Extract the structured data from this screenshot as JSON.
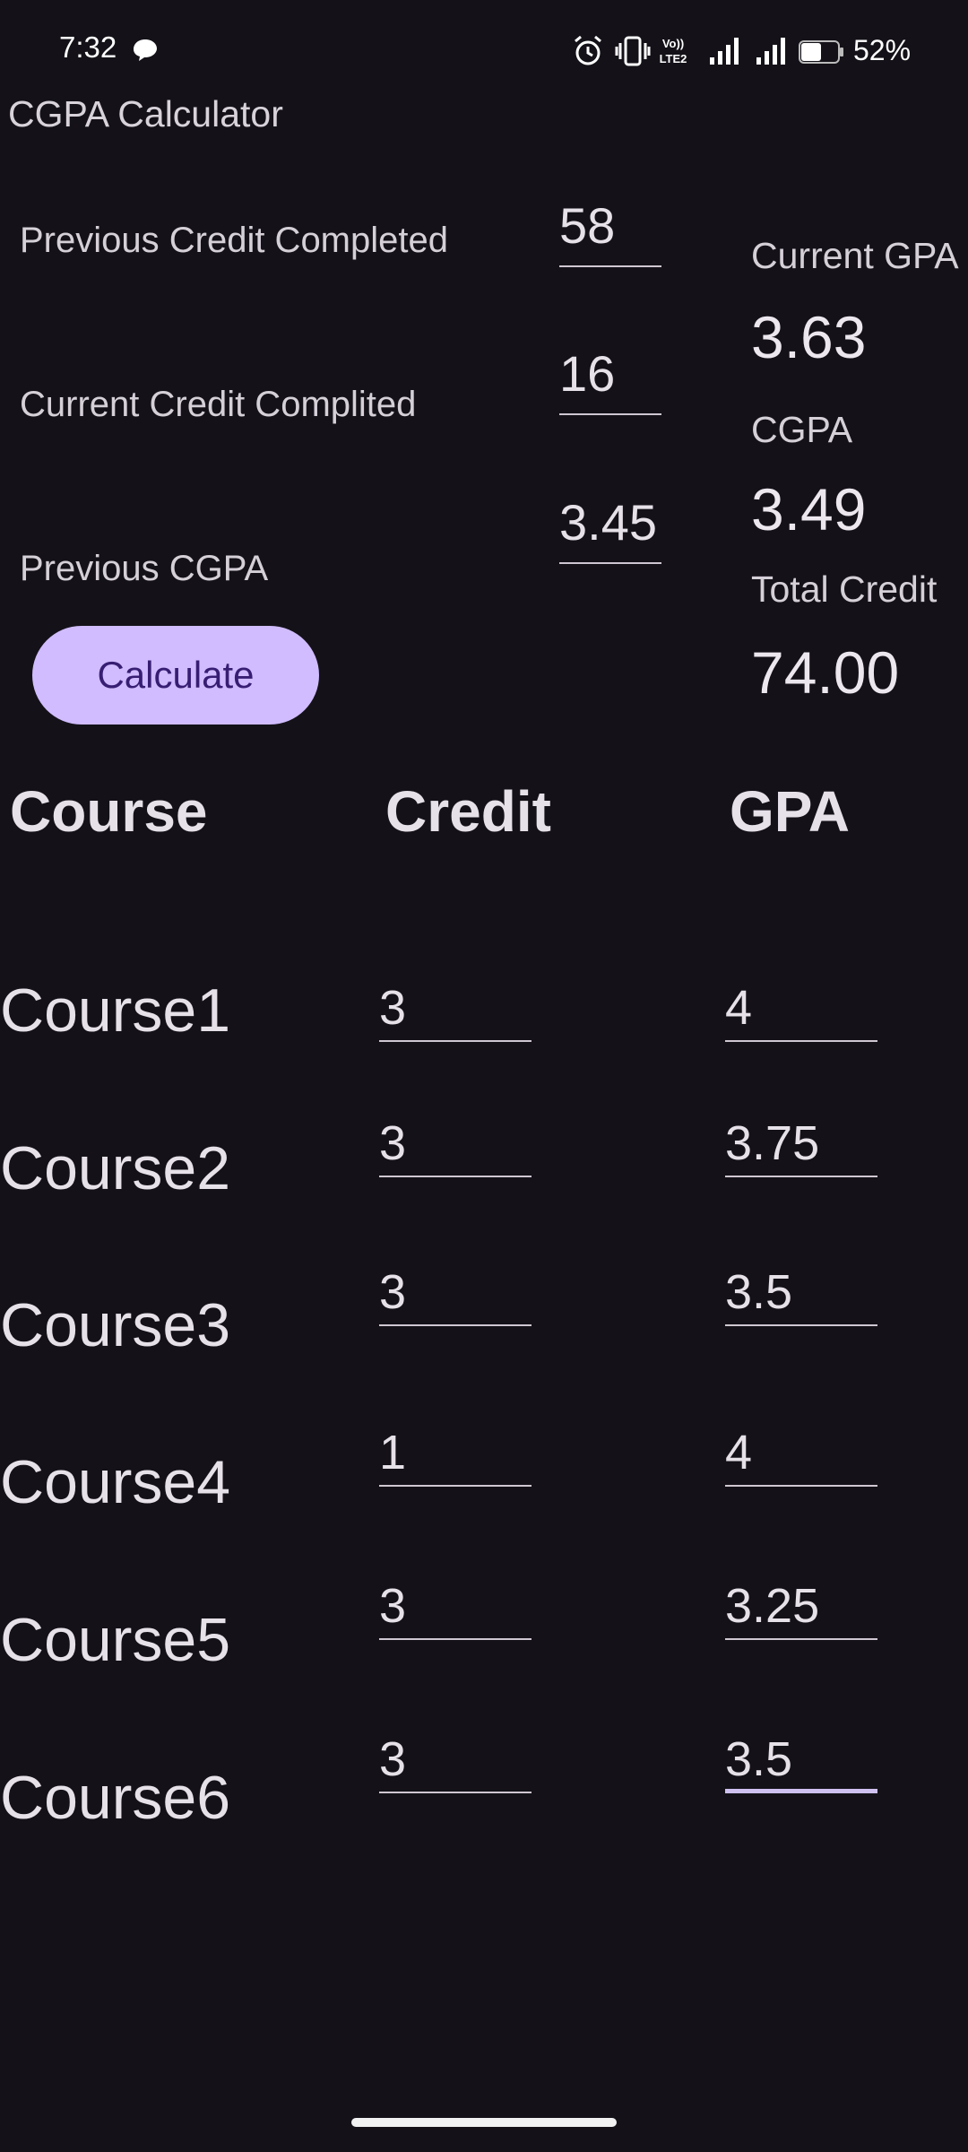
{
  "status_bar": {
    "time": "7:32",
    "battery": "52%",
    "icons": [
      "chat-bubble-icon",
      "alarm-icon",
      "vibrate-icon",
      "volte-icon",
      "signal-icon",
      "signal-icon",
      "battery-icon"
    ]
  },
  "app": {
    "title": "CGPA Calculator"
  },
  "inputs": {
    "previous_credit": {
      "label": "Previous Credit Completed",
      "value": "58"
    },
    "current_credit": {
      "label": "Current Credit Complited",
      "value": "16"
    },
    "previous_cgpa": {
      "label": "Previous CGPA",
      "value": "3.45"
    }
  },
  "results": {
    "current_gpa": {
      "label": "Current GPA",
      "value": "3.63"
    },
    "cgpa": {
      "label": "CGPA",
      "value": "3.49"
    },
    "total_credit": {
      "label": "Total Credit",
      "value": "74.00"
    }
  },
  "calculate_button": {
    "label": "Calculate"
  },
  "table": {
    "headers": [
      "Course",
      "Credit",
      "GPA"
    ],
    "rows": [
      {
        "course": "Course1",
        "credit": "3",
        "gpa": "4"
      },
      {
        "course": "Course2",
        "credit": "3",
        "gpa": "3.75"
      },
      {
        "course": "Course3",
        "credit": "3",
        "gpa": "3.5"
      },
      {
        "course": "Course4",
        "credit": "1",
        "gpa": "4"
      },
      {
        "course": "Course5",
        "credit": "3",
        "gpa": "3.25"
      },
      {
        "course": "Course6",
        "credit": "3",
        "gpa": "3.5"
      }
    ]
  },
  "colors": {
    "background": "#141218",
    "button": "#D0BCFF",
    "button_text": "#381E72",
    "text": "#E6E0E9"
  }
}
